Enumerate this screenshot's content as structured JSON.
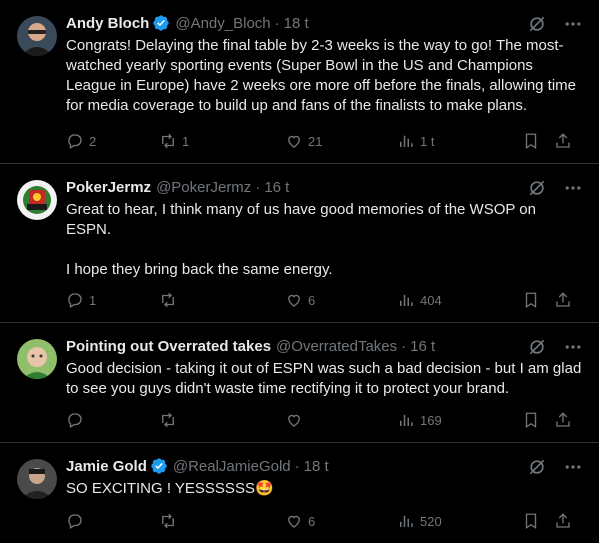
{
  "tweets": [
    {
      "name": "Andy Bloch",
      "handle": "@Andy_Bloch",
      "time": "18 t",
      "verified": true,
      "text": "Congrats! Delaying the final table by 2-3 weeks is the way to go! The most-watched yearly sporting events (Super Bowl in the US and Champions League in Europe) have 2 weeks ore more off before the finals, allowing time for media coverage to build up and fans of the finalists to make plans.",
      "replies": "2",
      "retweets": "1",
      "likes": "21",
      "views": "1 t"
    },
    {
      "name": "PokerJermz",
      "handle": "@PokerJermz",
      "time": "16 t",
      "verified": false,
      "text": "Great to hear, I think many of us have good memories of the WSOP on ESPN.\n\nI hope they bring back the same energy.",
      "replies": "1",
      "retweets": "",
      "likes": "6",
      "views": "404"
    },
    {
      "name": "Pointing out Overrated takes",
      "handle": "@OverratedTakes",
      "time": "16 t",
      "verified": false,
      "text": "Good decision - taking it out of ESPN was such a bad decision - but I am glad to see you guys didn't waste time rectifying it to protect your brand.",
      "replies": "",
      "retweets": "",
      "likes": "",
      "views": "169"
    },
    {
      "name": "Jamie Gold",
      "handle": "@RealJamieGold",
      "time": "18 t",
      "verified": true,
      "text": "SO EXCITING ! YESSSSSS🤩",
      "replies": "",
      "retweets": "",
      "likes": "6",
      "views": "520"
    }
  ],
  "colors": {
    "background": "#000000",
    "text": "#e7e9ea",
    "secondary": "#71767b",
    "divider": "#2f3336",
    "verified": "#1d9bf0"
  }
}
